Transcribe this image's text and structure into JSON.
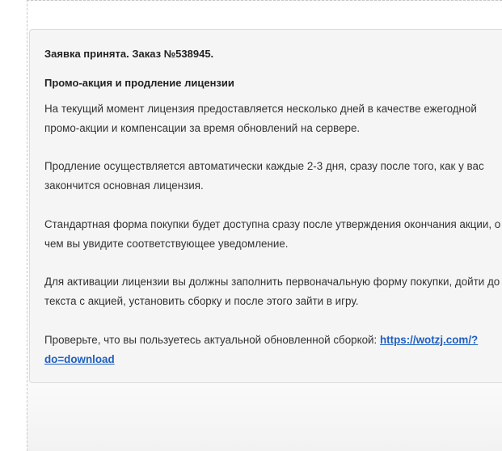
{
  "order": {
    "title": "Заявка принята. Заказ №538945."
  },
  "promo": {
    "heading": "Промо-акция и продление лицензии",
    "paragraphs": [
      "На текущий момент лицензия предоставляется несколько дней в качестве ежегодной промо-акции и компенсации за время обновлений на сервере.",
      "Продление осуществляется автоматически каждые 2-3 дня, сразу после того, как у вас закончится основная лицензия.",
      "Стандартная форма покупки будет доступна сразу после утверждения окончания акции, о чем вы увидите соответствующее уведомление.",
      "Для активации лицензии вы должны заполнить первоначальную форму покупки, дойти до текста с акцией, установить сборку и после этого зайти в игру."
    ],
    "check_text": "Проверьте, что вы пользуетесь актуальной обновленной сборкой: ",
    "download_link_text": "https://wotzj.com/?do=download"
  }
}
